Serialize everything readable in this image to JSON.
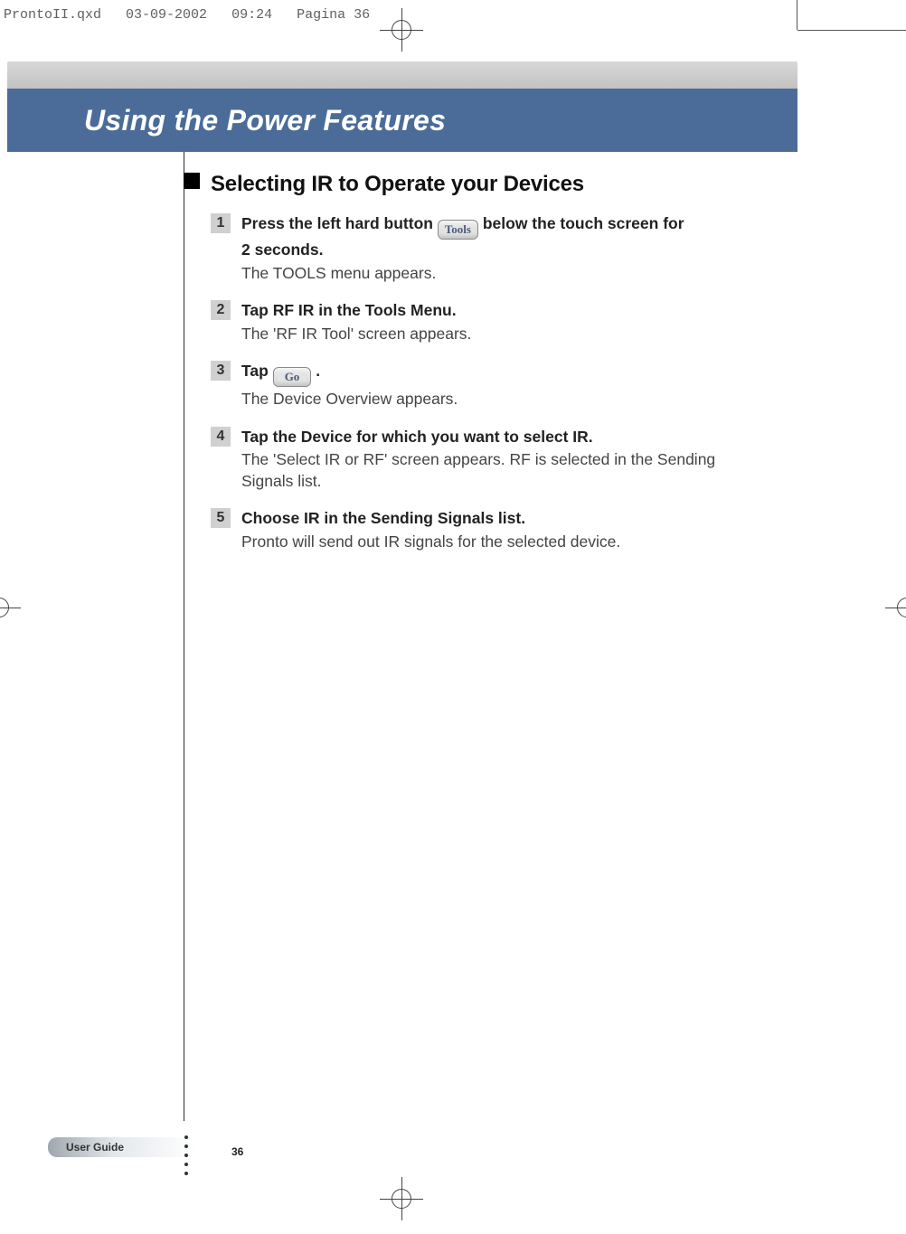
{
  "print_meta": {
    "filename": "ProntoII.qxd",
    "date": "03-09-2002",
    "time": "09:24",
    "page_marker": "Pagina 36"
  },
  "header": {
    "chapter_title": "Using the Power Features"
  },
  "section": {
    "title": "Selecting IR to Operate your Devices"
  },
  "buttons": {
    "tools": "Tools",
    "go": "Go"
  },
  "steps": [
    {
      "num": "1",
      "instr_a": "Press the left hard button ",
      "instr_b": " below the touch screen for",
      "instr_c": "2 seconds.",
      "result": "The TOOLS menu appears."
    },
    {
      "num": "2",
      "instr_a": "Tap ",
      "bold": "RF IR",
      "instr_b": " in the Tools Menu.",
      "result": "The 'RF IR Tool' screen appears."
    },
    {
      "num": "3",
      "instr_a": "Tap ",
      "instr_b": " .",
      "result": "The Device Overview appears."
    },
    {
      "num": "4",
      "instr_a": "Tap the Device for which you want to select IR.",
      "result": "The 'Select IR or RF' screen appears. RF is selected in the Sending Signals list."
    },
    {
      "num": "5",
      "instr_a": "Choose ",
      "bold": "IR",
      "instr_b": " in the Sending Signals list.",
      "result": "Pronto will send out IR signals for the selected device."
    }
  ],
  "footer": {
    "label": "User Guide",
    "page_number": "36"
  }
}
